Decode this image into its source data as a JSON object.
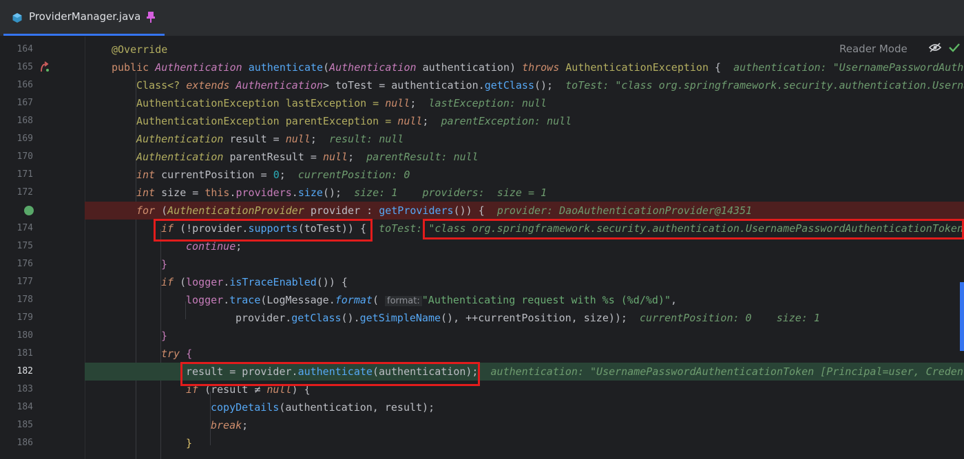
{
  "tab": {
    "filename": "ProviderManager.java"
  },
  "toolbar": {
    "reader_mode_label": "Reader Mode"
  },
  "lines": {
    "l164": {
      "num": "164"
    },
    "l165": {
      "num": "165"
    },
    "l166": {
      "num": "166"
    },
    "l167": {
      "num": "167"
    },
    "l168": {
      "num": "168"
    },
    "l169": {
      "num": "169"
    },
    "l170": {
      "num": "170"
    },
    "l171": {
      "num": "171"
    },
    "l172": {
      "num": "172"
    },
    "l174": {
      "num": "174"
    },
    "l175": {
      "num": "175"
    },
    "l176": {
      "num": "176"
    },
    "l177": {
      "num": "177"
    },
    "l178": {
      "num": "178"
    },
    "l179": {
      "num": "179"
    },
    "l180": {
      "num": "180"
    },
    "l181": {
      "num": "181"
    },
    "l182": {
      "num": "182"
    },
    "l183": {
      "num": "183"
    },
    "l184": {
      "num": "184"
    },
    "l185": {
      "num": "185"
    },
    "l186": {
      "num": "186"
    }
  },
  "code": {
    "annotation": "@Override",
    "l165": {
      "k1": "public",
      "t1": "Authentication",
      "fn": "authenticate",
      "t2": "Authentication",
      "p": "authentication",
      "k2": "throws",
      "t3": "AuthenticationException",
      "hint": "authentication: \"UsernamePasswordAuthe"
    },
    "l166": {
      "a": "Class<?",
      "k": "extends",
      "t": "Authentication",
      "b": "> toTest = authentication.",
      "fn": "getClass",
      "c": "();",
      "hint": "toTest: \"class org.springframework.security.authentication.Userna"
    },
    "l167": {
      "a": "AuthenticationException lastException = ",
      "k": "null",
      "c": ";",
      "hint": "lastException: null"
    },
    "l168": {
      "a": "AuthenticationException parentException = ",
      "k": "null",
      "c": ";",
      "hint": "parentException: null"
    },
    "l169": {
      "t": "Authentication",
      "a": " result = ",
      "k": "null",
      "c": ";",
      "hint": "result: null"
    },
    "l170": {
      "t": "Authentication",
      "a": " parentResult = ",
      "k": "null",
      "c": ";",
      "hint": "parentResult: null"
    },
    "l171": {
      "k": "int",
      "a": " currentPosition = ",
      "n": "0",
      "c": ";",
      "hint": "currentPosition: 0"
    },
    "l172": {
      "k": "int",
      "a": " size = ",
      "k2": "this",
      "b": ".",
      "f": "providers",
      "c": ".",
      "fn": "size",
      "d": "();",
      "hint1": "size: 1",
      "hint2": "providers:  size = 1"
    },
    "l173": {
      "k": "for",
      "a": " (",
      "t": "AuthenticationProvider",
      "b": " provider : ",
      "fn": "getProviders",
      "c": "()) {",
      "hint": "provider: DaoAuthenticationProvider@14351"
    },
    "l174": {
      "k": "if",
      "a": " (!provider.",
      "fn": "supports",
      "b": "(toTest)) {",
      "hint_label": "toTest:",
      "hint_val": "\"class org.springframework.security.authentication.UsernamePasswordAuthenticationToken"
    },
    "l175": {
      "k": "continue",
      "c": ";"
    },
    "l176": {
      "c": "}"
    },
    "l177": {
      "k": "if",
      "a": " (",
      "f": "logger",
      "b": ".",
      "fn": "isTraceEnabled",
      "c": "()) {"
    },
    "l178": {
      "f": "logger",
      "a": ".",
      "fn": "trace",
      "b": "(LogMessage.",
      "fn2": "format",
      "c": "(",
      "param": "format:",
      "s": "\"Authenticating request with %s (%d/%d)\"",
      "d": ","
    },
    "l179": {
      "a": "provider.",
      "fn": "getClass",
      "b": "().",
      "fn2": "getSimpleName",
      "c": "(), ++currentPosition, size));",
      "hint1": "currentPosition: 0",
      "hint2": "size: 1"
    },
    "l180": {
      "c": "}"
    },
    "l181": {
      "k": "try",
      "c": " {"
    },
    "l182": {
      "a": "result = provider.",
      "fn": "authenticate",
      "b": "(authentication);",
      "hint": "authentication: \"UsernamePasswordAuthenticationToken [Principal=user, Credent"
    },
    "l183": {
      "k": "if",
      "a": " (result ",
      "op": "≠",
      "b": " ",
      "k2": "null",
      "c": ") {"
    },
    "l184": {
      "fn": "copyDetails",
      "a": "(authentication, result);"
    },
    "l185": {
      "k": "break",
      "c": ";"
    },
    "l186": {
      "c": "}"
    }
  },
  "colors": {
    "breakpoint_line": "#4e1f1f",
    "execution_line": "#294436",
    "highlight_box": "#e21c1c",
    "accent": "#3574f0"
  },
  "icons": {
    "file": "java-file-icon",
    "pin": "pin-icon",
    "reader": "reader-mode-icon",
    "check": "check-icon",
    "breakpoint": "breakpoint-icon",
    "implements": "implements-icon"
  }
}
